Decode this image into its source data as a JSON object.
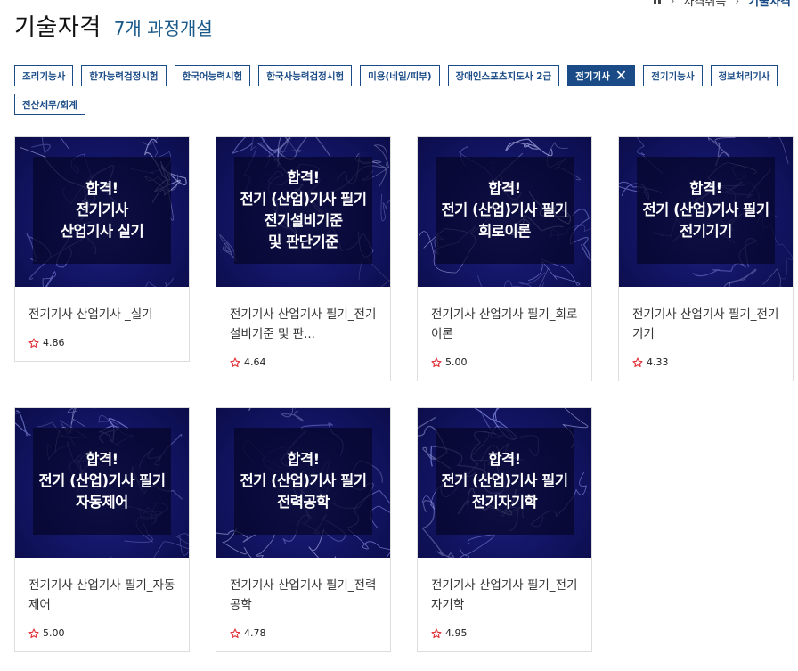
{
  "breadcrumb": {
    "items": [
      "자격취득",
      "기술자격"
    ]
  },
  "header": {
    "title": "기술자격",
    "count": "7개 과정개설"
  },
  "filters": [
    {
      "label": "조리기능사",
      "active": false
    },
    {
      "label": "한자능력검정시험",
      "active": false
    },
    {
      "label": "한국어능력시험",
      "active": false
    },
    {
      "label": "한국사능력검정시험",
      "active": false
    },
    {
      "label": "미용(네일/피부)",
      "active": false
    },
    {
      "label": "장애인스포츠지도사 2급",
      "active": false
    },
    {
      "label": "전기기사",
      "active": true
    },
    {
      "label": "전기기능사",
      "active": false
    },
    {
      "label": "정보처리기사",
      "active": false
    },
    {
      "label": "전산세무/회계",
      "active": false
    }
  ],
  "courses": [
    {
      "thumb_lines": [
        "합격!",
        "전기기사",
        "산업기사 실기"
      ],
      "title": "전기기사 산업기사 _실기",
      "rating": "4.86"
    },
    {
      "thumb_lines": [
        "합격!",
        "전기 (산업)기사 필기",
        "전기설비기준",
        "및 판단기준"
      ],
      "title": "전기기사 산업기사 필기_전기설비기준 및 판...",
      "rating": "4.64"
    },
    {
      "thumb_lines": [
        "합격!",
        "전기 (산업)기사 필기",
        "회로이론"
      ],
      "title": "전기기사 산업기사 필기_회로이론",
      "rating": "5.00"
    },
    {
      "thumb_lines": [
        "합격!",
        "전기 (산업)기사 필기",
        "전기기기"
      ],
      "title": "전기기사 산업기사 필기_전기기기",
      "rating": "4.33"
    },
    {
      "thumb_lines": [
        "합격!",
        "전기 (산업)기사 필기",
        "자동제어"
      ],
      "title": "전기기사 산업기사 필기_자동제어",
      "rating": "5.00"
    },
    {
      "thumb_lines": [
        "합격!",
        "전기 (산업)기사 필기",
        "전력공학"
      ],
      "title": "전기기사 산업기사 필기_전력공학",
      "rating": "4.78"
    },
    {
      "thumb_lines": [
        "합격!",
        "전기 (산업)기사 필기",
        "전기자기학"
      ],
      "title": "전기기사 산업기사 필기_전기자기학",
      "rating": "4.95"
    }
  ],
  "icons": {
    "home": "home-icon",
    "separator": "chevron-right-icon",
    "remove_filter": "close-icon",
    "rating": "star-outline-icon"
  },
  "colors": {
    "accent": "#1a4b86",
    "star": "#e0333a",
    "thumb_bg": "#14166a"
  }
}
